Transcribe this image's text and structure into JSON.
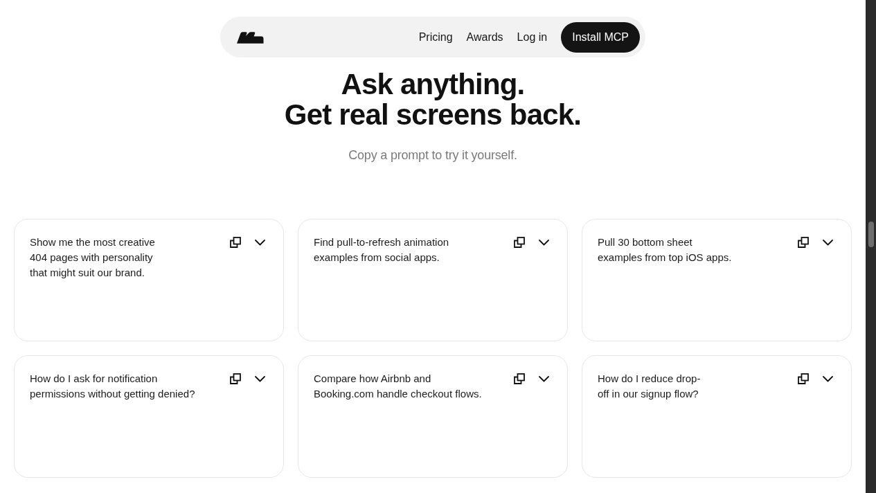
{
  "nav": {
    "links": [
      {
        "label": "Pricing"
      },
      {
        "label": "Awards"
      },
      {
        "label": "Log in"
      }
    ],
    "cta": "Install MCP"
  },
  "hero": {
    "title": "Ask anything.\nGet real screens back.",
    "subtitle": "Copy a prompt to try it yourself."
  },
  "prompts": [
    {
      "text": "Show me the most creative\n404 pages with personality\nthat might suit our brand.",
      "expanded": false
    },
    {
      "text": "Find pull-to-refresh animation\nexamples from social apps.",
      "expanded": false
    },
    {
      "text": "Pull 30 bottom sheet\nexamples from top iOS apps.",
      "expanded": false
    },
    {
      "text": "How do I ask for notification\npermissions without getting denied?",
      "expanded": false
    },
    {
      "text": "Compare how Airbnb and\nBooking.com handle checkout flows.",
      "expanded": false
    },
    {
      "text": "How do I reduce drop-\noff in our signup flow?",
      "expanded": false
    }
  ]
}
